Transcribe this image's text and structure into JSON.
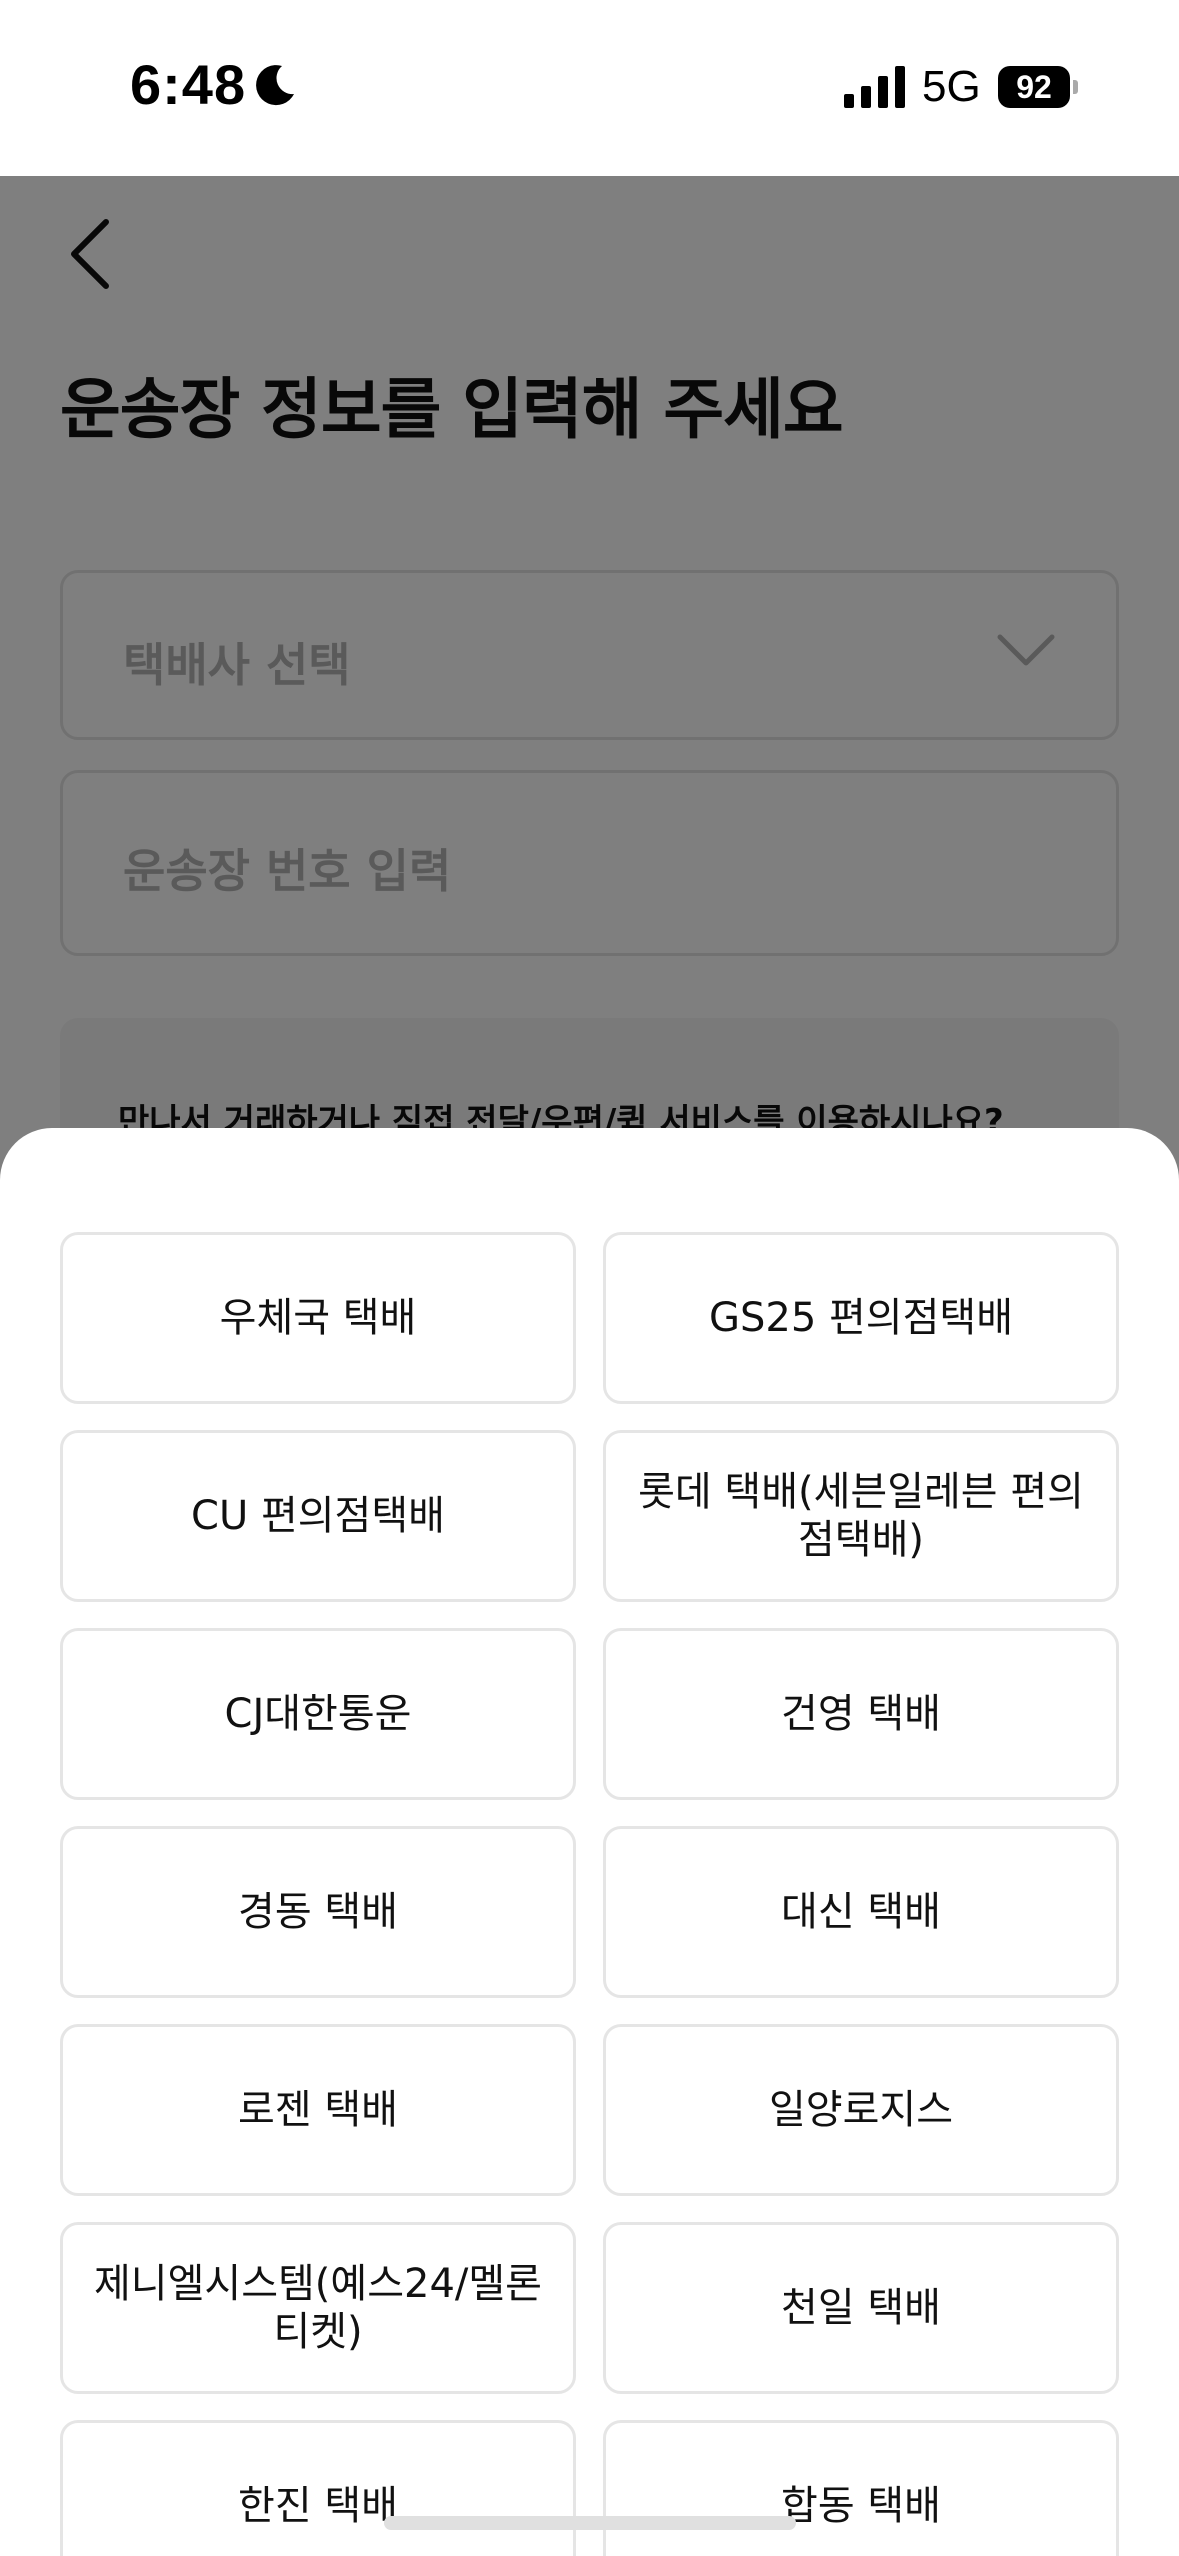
{
  "status_bar": {
    "time": "6:48",
    "network": "5G",
    "battery": "92"
  },
  "page": {
    "title": "운송장 정보를 입력해 주세요",
    "carrier_select_placeholder": "택배사 선택",
    "tracking_input_placeholder": "운송장 번호 입력",
    "info_text": "만나서 거래하거나 직접 전달/우편/퀵 서비스를 이용하시나요?"
  },
  "sheet": {
    "carriers": [
      "우체국 택배",
      "GS25 편의점택배",
      "CU 편의점택배",
      "롯데 택배(세븐일레븐 편의점택배)",
      "CJ대한통운",
      "건영 택배",
      "경동 택배",
      "대신 택배",
      "로젠 택배",
      "일양로지스",
      "제니엘시스템(예스24/멜론티켓)",
      "천일 택배",
      "한진 택배",
      "합동 택배"
    ]
  },
  "colors": {
    "overlay": "#000000",
    "border": "#e5e5e5",
    "placeholder": "#b5b5b5"
  }
}
